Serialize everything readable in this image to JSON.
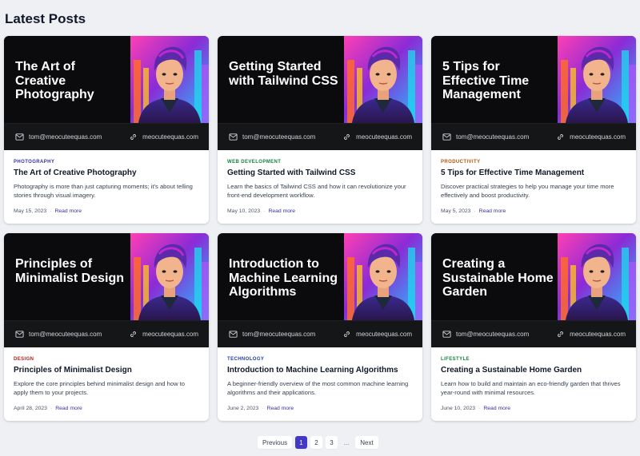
{
  "heading": "Latest Posts",
  "posts": [
    {
      "banner_title": "The Art of Creative Photography",
      "email": "tom@meocuteequas.com",
      "site": "meocuteequas.com",
      "category": "PHOTOGRAPHY",
      "category_color": "#3730a3",
      "title": "The Art of Creative Photography",
      "excerpt": "Photography is more than just capturing moments; it's about telling stories through visual imagery.",
      "date": "May 15, 2023",
      "read_more": "Read more"
    },
    {
      "banner_title": "Getting Started with Tailwind CSS",
      "email": "tom@meocuteequas.com",
      "site": "meocuteequas.com",
      "category": "WEB DEVELOPMENT",
      "category_color": "#15803d",
      "title": "Getting Started with Tailwind CSS",
      "excerpt": "Learn the basics of Tailwind CSS and how it can revolutionize your front-end development workflow.",
      "date": "May 10, 2023",
      "read_more": "Read more"
    },
    {
      "banner_title": "5 Tips for Effective Time Management",
      "email": "tom@meocuteequas.com",
      "site": "meocuteequas.com",
      "category": "PRODUCTIVITY",
      "category_color": "#b45309",
      "title": "5 Tips for Effective Time Management",
      "excerpt": "Discover practical strategies to help you manage your time more effectively and boost productivity.",
      "date": "May 5, 2023",
      "read_more": "Read more"
    },
    {
      "banner_title": "Principles of Minimalist Design",
      "email": "tom@meocuteequas.com",
      "site": "meocuteequas.com",
      "category": "DESIGN",
      "category_color": "#b91c1c",
      "title": "Principles of Minimalist Design",
      "excerpt": "Explore the core principles behind minimalist design and how to apply them to your projects.",
      "date": "April 28, 2023",
      "read_more": "Read more"
    },
    {
      "banner_title": "Introduction to Machine Learning Algorithms",
      "email": "tom@meocuteequas.com",
      "site": "meocuteequas.com",
      "category": "TECHNOLOGY",
      "category_color": "#1e40af",
      "title": "Introduction to Machine Learning Algorithms",
      "excerpt": "A beginner-friendly overview of the most common machine learning algorithms and their applications.",
      "date": "June 2, 2023",
      "read_more": "Read more"
    },
    {
      "banner_title": "Creating a Sustainable Home Garden",
      "email": "tom@meocuteequas.com",
      "site": "meocuteequas.com",
      "category": "LIFESTYLE",
      "category_color": "#15803d",
      "title": "Creating a Sustainable Home Garden",
      "excerpt": "Learn how to build and maintain an eco-friendly garden that thrives year-round with minimal resources.",
      "date": "June 10, 2023",
      "read_more": "Read more"
    }
  ],
  "pagination": {
    "previous": "Previous",
    "pages": [
      "1",
      "2",
      "3"
    ],
    "current": "1",
    "ellipsis": "...",
    "next": "Next"
  },
  "icons": {
    "email": "mail-icon",
    "site": "link-icon",
    "portrait": "avatar-illustration"
  },
  "colors": {
    "page_bg": "#eef0f4",
    "accent": "#4338ca",
    "banner_bg": "#0b0b0d"
  }
}
